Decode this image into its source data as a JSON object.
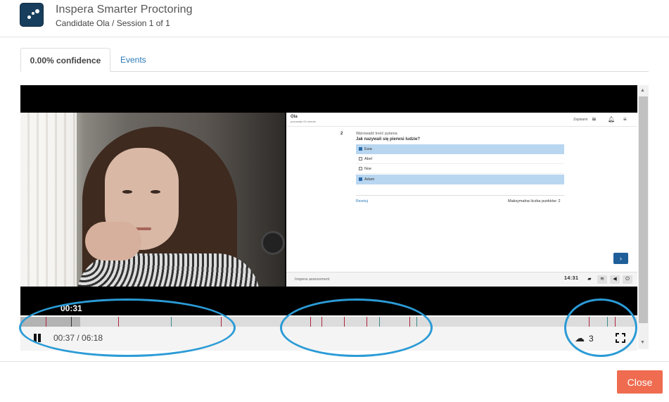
{
  "header": {
    "title": "Inspera Smarter Proctoring",
    "subtitle": "Candidate Ola / Session 1 of 1"
  },
  "tabs": [
    {
      "label": "0.00% confidence",
      "active": true
    },
    {
      "label": "Events",
      "active": false
    }
  ],
  "video": {
    "time_bubble": "00:31",
    "screen": {
      "candidate_name": "Ola",
      "time_left": "pozostało 03 minute",
      "saved_label": "Zapisano",
      "question_number": "2",
      "instruction": "Wprowadź treść pytania",
      "question": "Jak nazywali się pierwsi ludzie?",
      "options": [
        {
          "label": "Ewa",
          "selected": true
        },
        {
          "label": "Abel",
          "selected": false
        },
        {
          "label": "Noe",
          "selected": false
        },
        {
          "label": "Adam",
          "selected": true
        }
      ],
      "reset_label": "Resetuj",
      "max_points": "Maksymalna liczba punktów: 2",
      "next_glyph": "›",
      "brand": "Inspera assessment",
      "clock": "14:31"
    }
  },
  "timeline": {
    "played_fraction": 0.097,
    "markers": [
      {
        "pos": 0.041,
        "color": "#b0223a"
      },
      {
        "pos": 0.159,
        "color": "#b0223a"
      },
      {
        "pos": 0.244,
        "color": "#3a8a8a"
      },
      {
        "pos": 0.325,
        "color": "#b0223a"
      },
      {
        "pos": 0.47,
        "color": "#b0223a"
      },
      {
        "pos": 0.488,
        "color": "#b0223a"
      },
      {
        "pos": 0.525,
        "color": "#b0223a"
      },
      {
        "pos": 0.561,
        "color": "#b0223a"
      },
      {
        "pos": 0.582,
        "color": "#3a8a8a"
      },
      {
        "pos": 0.631,
        "color": "#b0223a"
      },
      {
        "pos": 0.642,
        "color": "#3a8a8a"
      },
      {
        "pos": 0.921,
        "color": "#b0223a"
      },
      {
        "pos": 0.951,
        "color": "#3a8a8a"
      },
      {
        "pos": 0.963,
        "color": "#b0223a"
      }
    ]
  },
  "controls": {
    "time_readout": "00:37 / 06:18",
    "download_count": "3"
  },
  "footer": {
    "close_label": "Close"
  },
  "colors": {
    "accent": "#2b9bd6",
    "close_button": "#ef6c50",
    "logo": "#173e5c"
  }
}
